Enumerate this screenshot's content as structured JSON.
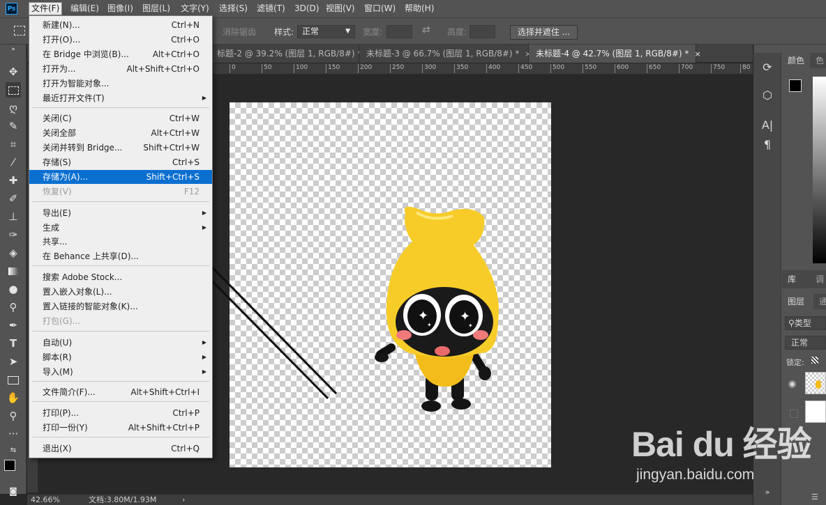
{
  "app": {
    "logo_text": "Ps"
  },
  "menubar": {
    "items": [
      "文件(F)",
      "编辑(E)",
      "图像(I)",
      "图层(L)",
      "文字(Y)",
      "选择(S)",
      "滤镜(T)",
      "3D(D)",
      "视图(V)",
      "窗口(W)",
      "帮助(H)"
    ],
    "active_index": 0
  },
  "options_bar": {
    "anti_alias_label": "消除锯齿",
    "style_label": "样式:",
    "style_value": "正常",
    "width_label": "宽度:",
    "height_label": "高度:",
    "select_mask_button": "选择并遮住 ..."
  },
  "tabs": [
    {
      "label": "标题-2 @ 39.2% (图层 1, RGB/8#) *",
      "close": "×"
    },
    {
      "label": "未标题-3 @ 66.7% (图层 1, RGB/8#) *",
      "close": "×"
    },
    {
      "label": "未标题-4 @ 42.7% (图层 1, RGB/8#) *",
      "close": "×"
    }
  ],
  "ruler": {
    "ticks": [
      "0",
      "50",
      "100",
      "150",
      "200",
      "250",
      "300",
      "350",
      "400",
      "450",
      "500",
      "550",
      "600",
      "650",
      "700",
      "750",
      "80"
    ]
  },
  "file_menu": {
    "items": [
      {
        "label": "新建(N)...",
        "shortcut": "Ctrl+N"
      },
      {
        "label": "打开(O)...",
        "shortcut": "Ctrl+O"
      },
      {
        "label": "在 Bridge 中浏览(B)...",
        "shortcut": "Alt+Ctrl+O"
      },
      {
        "label": "打开为...",
        "shortcut": "Alt+Shift+Ctrl+O"
      },
      {
        "label": "打开为智能对象...",
        "shortcut": ""
      },
      {
        "label": "最近打开文件(T)",
        "shortcut": "",
        "submenu": true
      },
      {
        "label": "关闭(C)",
        "shortcut": "Ctrl+W"
      },
      {
        "label": "关闭全部",
        "shortcut": "Alt+Ctrl+W"
      },
      {
        "label": "关闭并转到 Bridge...",
        "shortcut": "Shift+Ctrl+W"
      },
      {
        "label": "存储(S)",
        "shortcut": "Ctrl+S"
      },
      {
        "label": "存储为(A)...",
        "shortcut": "Shift+Ctrl+S",
        "highlighted": true
      },
      {
        "label": "恢复(V)",
        "shortcut": "F12",
        "disabled": true
      },
      {
        "label": "导出(E)",
        "shortcut": "",
        "submenu": true
      },
      {
        "label": "生成",
        "shortcut": "",
        "submenu": true
      },
      {
        "label": "共享...",
        "shortcut": ""
      },
      {
        "label": "在 Behance 上共享(D)...",
        "shortcut": ""
      },
      {
        "label": "搜索 Adobe Stock...",
        "shortcut": ""
      },
      {
        "label": "置入嵌入对象(L)...",
        "shortcut": ""
      },
      {
        "label": "置入链接的智能对象(K)...",
        "shortcut": ""
      },
      {
        "label": "打包(G)...",
        "shortcut": "",
        "disabled": true
      },
      {
        "label": "自动(U)",
        "shortcut": "",
        "submenu": true
      },
      {
        "label": "脚本(R)",
        "shortcut": "",
        "submenu": true
      },
      {
        "label": "导入(M)",
        "shortcut": "",
        "submenu": true
      },
      {
        "label": "文件简介(F)...",
        "shortcut": "Alt+Shift+Ctrl+I"
      },
      {
        "label": "打印(P)...",
        "shortcut": "Ctrl+P"
      },
      {
        "label": "打印一份(Y)",
        "shortcut": "Alt+Shift+Ctrl+P"
      },
      {
        "label": "退出(X)",
        "shortcut": "Ctrl+Q"
      }
    ]
  },
  "statusbar": {
    "zoom": "42.66%",
    "doc_info": "文档:3.80M/1.93M",
    "arrow": "›"
  },
  "right_panel": {
    "color_tab": "颜色",
    "color_tab2": "色",
    "library_tab": "库",
    "adjust_tab": "调",
    "layers_tab": "图层",
    "channels_tab": "通",
    "kind_label": "类型",
    "blend_mode": "正常",
    "lock_label": "锁定:"
  },
  "watermark": {
    "text": "Bai du 经验",
    "url": "jingyan.baidu.com"
  },
  "colors": {
    "accent": "#0b6fd0",
    "ui_bg": "#535353",
    "canvas_bg": "#282828",
    "mascot": "#f5c623"
  }
}
